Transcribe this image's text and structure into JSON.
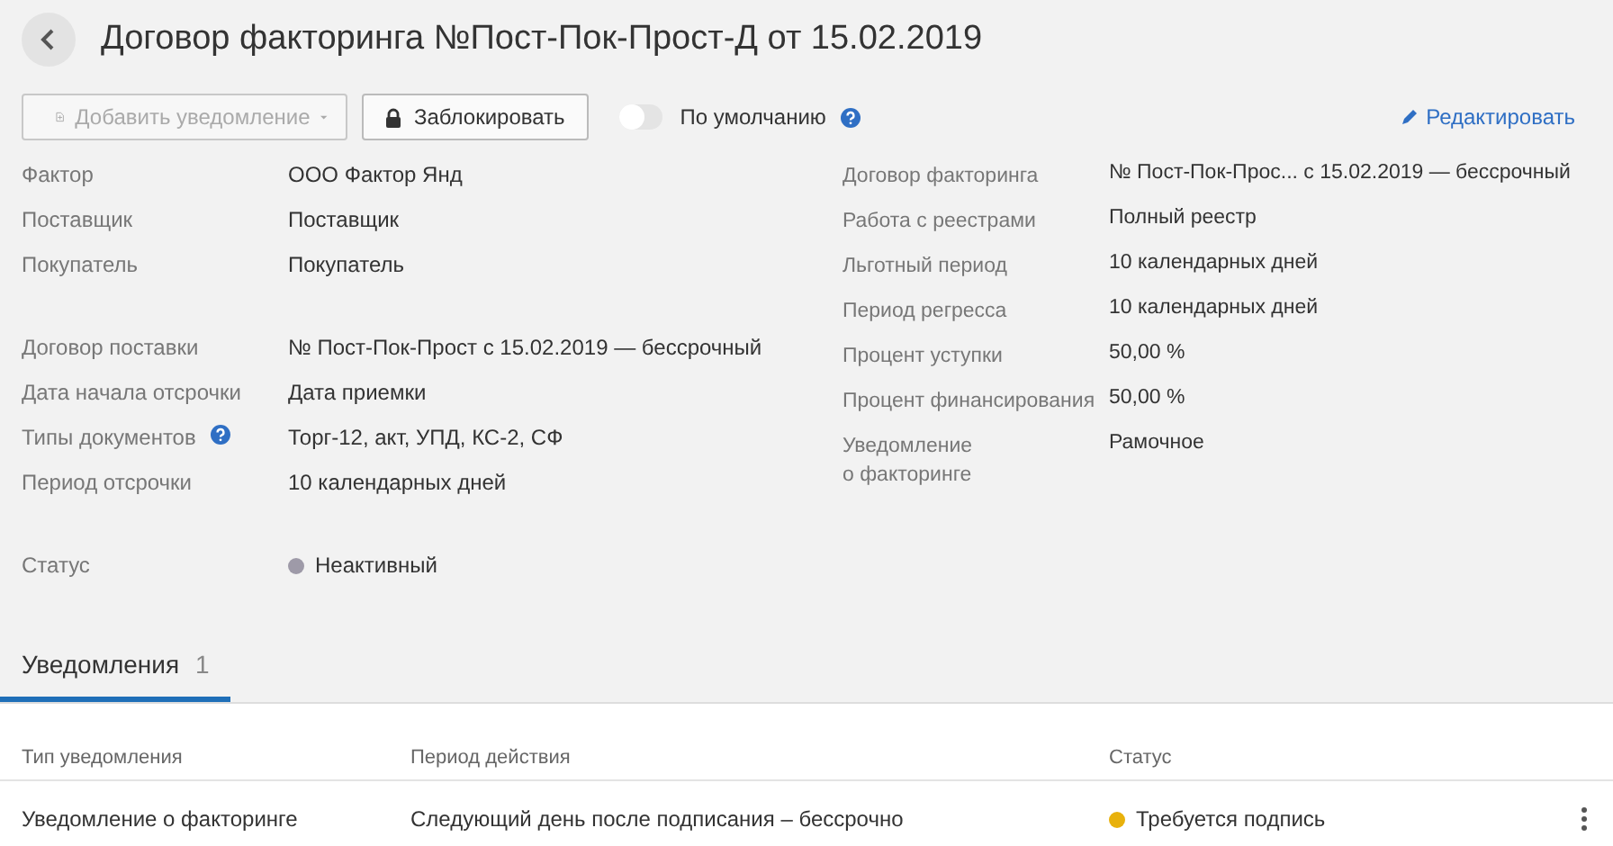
{
  "title": "Договор факторинга №Пост-Пок-Прост-Д от 15.02.2019",
  "toolbar": {
    "add_button": {
      "label": "Добавить уведомление",
      "disabled": true
    },
    "lock_button": {
      "label": "Заблокировать"
    },
    "default_toggle": {
      "label": "По умолчанию",
      "on": false
    },
    "edit_link": {
      "label": "Редактировать"
    }
  },
  "left_groups": [
    [
      {
        "label": "Фактор",
        "value": "ООО Фактор Янд"
      },
      {
        "label": "Поставщик",
        "value": "Поставщик"
      },
      {
        "label": "Покупатель",
        "value": "Покупатель"
      }
    ],
    [
      {
        "label": "Договор поставки",
        "value": "№ Пост-Пок-Прост с 15.02.2019 — бессрочный"
      },
      {
        "label": "Дата начала отсрочки",
        "value": "Дата приемки"
      },
      {
        "label": "Типы документов",
        "value": "Торг-12, акт, УПД, КС-2, СФ",
        "help": true
      },
      {
        "label": "Период отсрочки",
        "value": "10 календарных дней"
      }
    ],
    [
      {
        "label": "Статус",
        "value": "Неактивный",
        "color": "#9e9aa8"
      }
    ]
  ],
  "right_rows": [
    {
      "label": "Договор факторинга",
      "value": "№ Пост-Пок-Прос... с 15.02.2019 — бессрочный"
    },
    {
      "label": "Работа с реестрами",
      "value": "Полный реестр"
    },
    {
      "label": "Льготный период",
      "value": "10 календарных дней"
    },
    {
      "label": "Период регресса",
      "value": "10 календарных дней"
    },
    {
      "label": "Процент уступки",
      "value": "50,00 %"
    },
    {
      "label": "Процент финансирования",
      "value": "50,00 %"
    },
    {
      "label": "Уведомление\nо факторинге",
      "value": "Рамочное"
    }
  ],
  "tabs": [
    {
      "label": "Уведомления",
      "count": "1",
      "selected": true
    }
  ],
  "table": {
    "columns": [
      "Тип уведомления",
      "Период действия",
      "Статус"
    ],
    "rows": [
      {
        "type": "Уведомление о факторинге",
        "period": "Следующий день после подписания – бессрочно",
        "status": "Требуется подпись",
        "color": "#e8b10c"
      }
    ]
  }
}
